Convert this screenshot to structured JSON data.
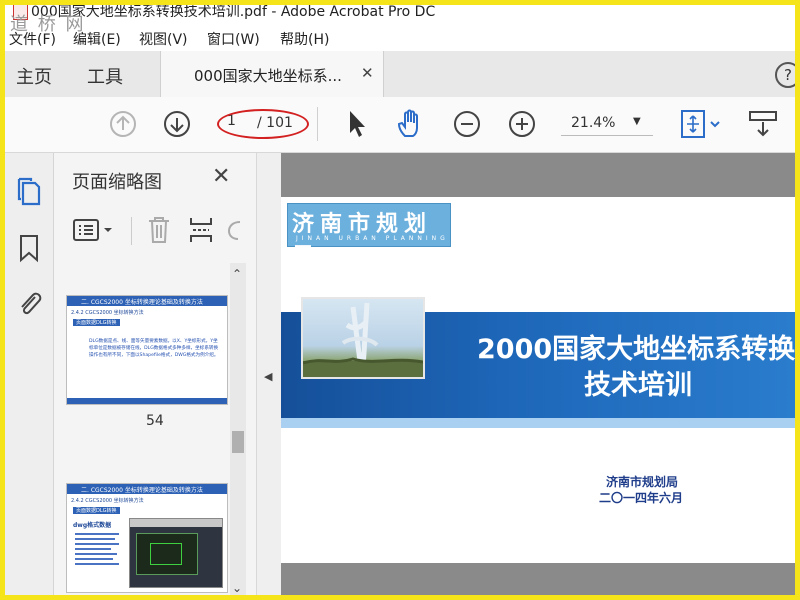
{
  "window": {
    "title": "000国家大地坐标系转换技术培训.pdf - Adobe Acrobat Pro DC",
    "watermark": "道 桥 网"
  },
  "menu": {
    "items": [
      "文件(F)",
      "编辑(E)",
      "视图(V)",
      "窗口(W)",
      "帮助(H)"
    ]
  },
  "tabs": {
    "home": "主页",
    "tools": "工具",
    "document": "000国家大地坐标系...",
    "close": "✕",
    "help": "?"
  },
  "toolbar": {
    "current_page": "1",
    "total_pages": "/ 101",
    "zoom": "21.4%"
  },
  "sidebar": {
    "panel_title": "页面缩略图",
    "close": "✕",
    "thumbnails": [
      {
        "number": "54",
        "header": "二. CGCS2000 坐标转换理论基础及转换方法",
        "sub": "2.4.2 CGCS2000 坐标转换方法",
        "chip": "页面数据DLG转换",
        "body": "DLG数据是点、线、面等矢量要素数据，以X、Y坐标形式，Y坐标单位是数据被存储在线，DLG数据格式多种多样，坐标系转换操作也有所不同，下面以Shapefile格式，DWG格式为例介绍。"
      },
      {
        "number": "",
        "header": "二. CGCS2000 坐标转换理论基础及转换方法",
        "sub": "2.4.2 CGCS2000 坐标转换方法",
        "chip": "页面数据DLG转换",
        "body": "dwg格式数据"
      }
    ]
  },
  "document": {
    "logo_text": "济南市规划局",
    "logo_en": "JINAN URBAN PLANNING",
    "title_line1": "2000国家大地坐标系转换",
    "title_line2": "技术培训",
    "organization": "济南市规划局",
    "date": "二〇一四年六月"
  },
  "colors": {
    "frame": "#f5e41a",
    "banner": "#1e67b9",
    "annotation_oval": "#d32020"
  }
}
